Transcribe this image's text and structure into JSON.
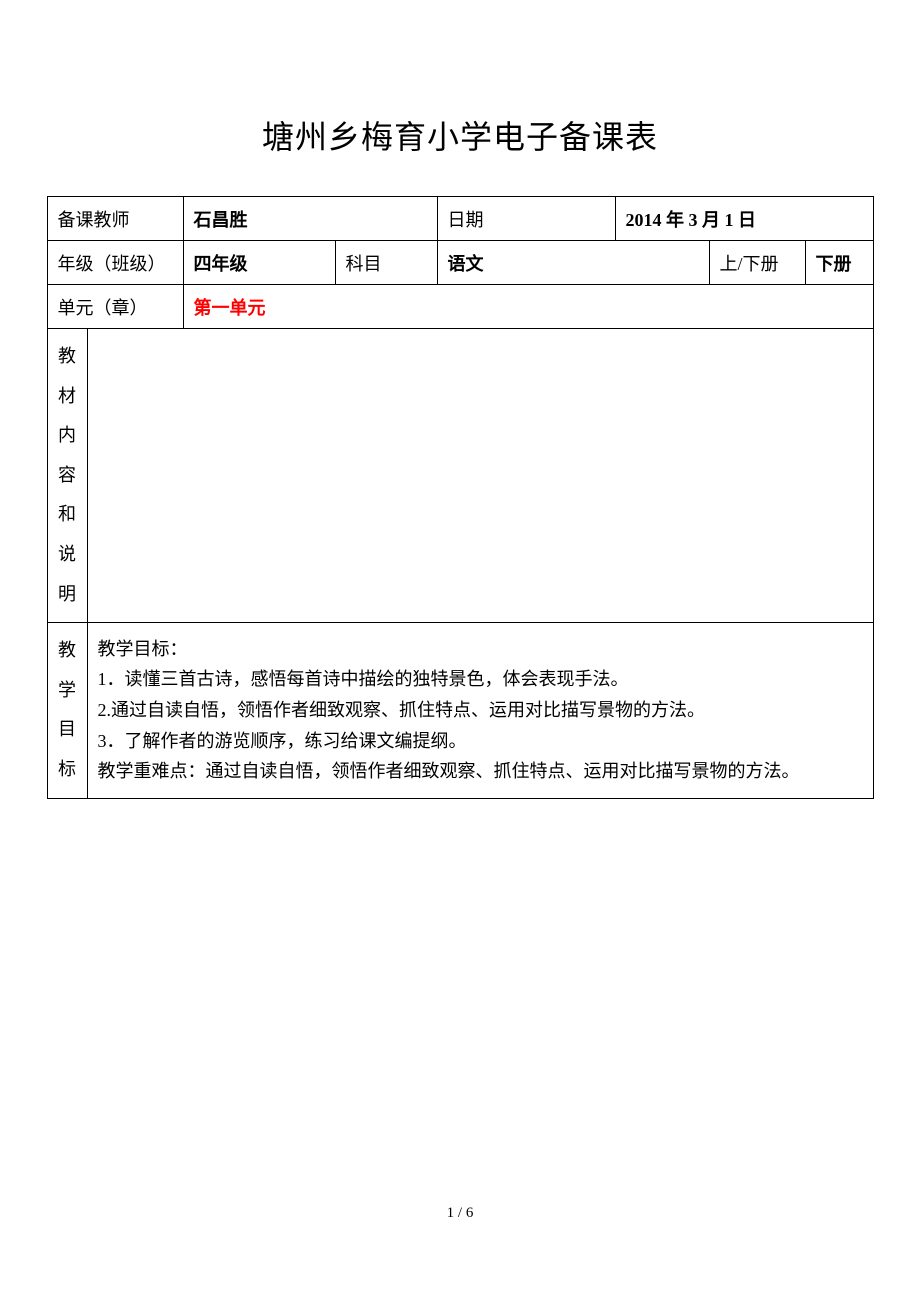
{
  "title": "塘州乡梅育小学电子备课表",
  "row1": {
    "teacher_label": "备课教师",
    "teacher_value": "石昌胜",
    "date_label": "日期",
    "date_value": "2014 年 3 月 1 日"
  },
  "row2": {
    "grade_label": "年级（班级）",
    "grade_value": "四年级",
    "subject_label": "科目",
    "subject_value": "语文",
    "semester_label": "上/下册",
    "semester_value": "下册"
  },
  "row3": {
    "unit_label": "单元（章）",
    "unit_value": "第一单元"
  },
  "section1": {
    "label_chars": [
      "教",
      "材",
      "内",
      "容",
      "和",
      "说",
      "明"
    ]
  },
  "section2": {
    "label_chars": [
      "教",
      "学",
      "目",
      "标"
    ],
    "content": {
      "heading": "教学目标：",
      "line1": "1．读懂三首古诗，感悟每首诗中描绘的独特景色，体会表现手法。",
      "line2": "2.通过自读自悟，领悟作者细致观察、抓住特点、运用对比描写景物的方法。",
      "line3": "3．了解作者的游览顺序，练习给课文编提纲。",
      "line4": "教学重难点：通过自读自悟，领悟作者细致观察、抓住特点、运用对比描写景物的方法。"
    }
  },
  "page_number": "1 / 6"
}
